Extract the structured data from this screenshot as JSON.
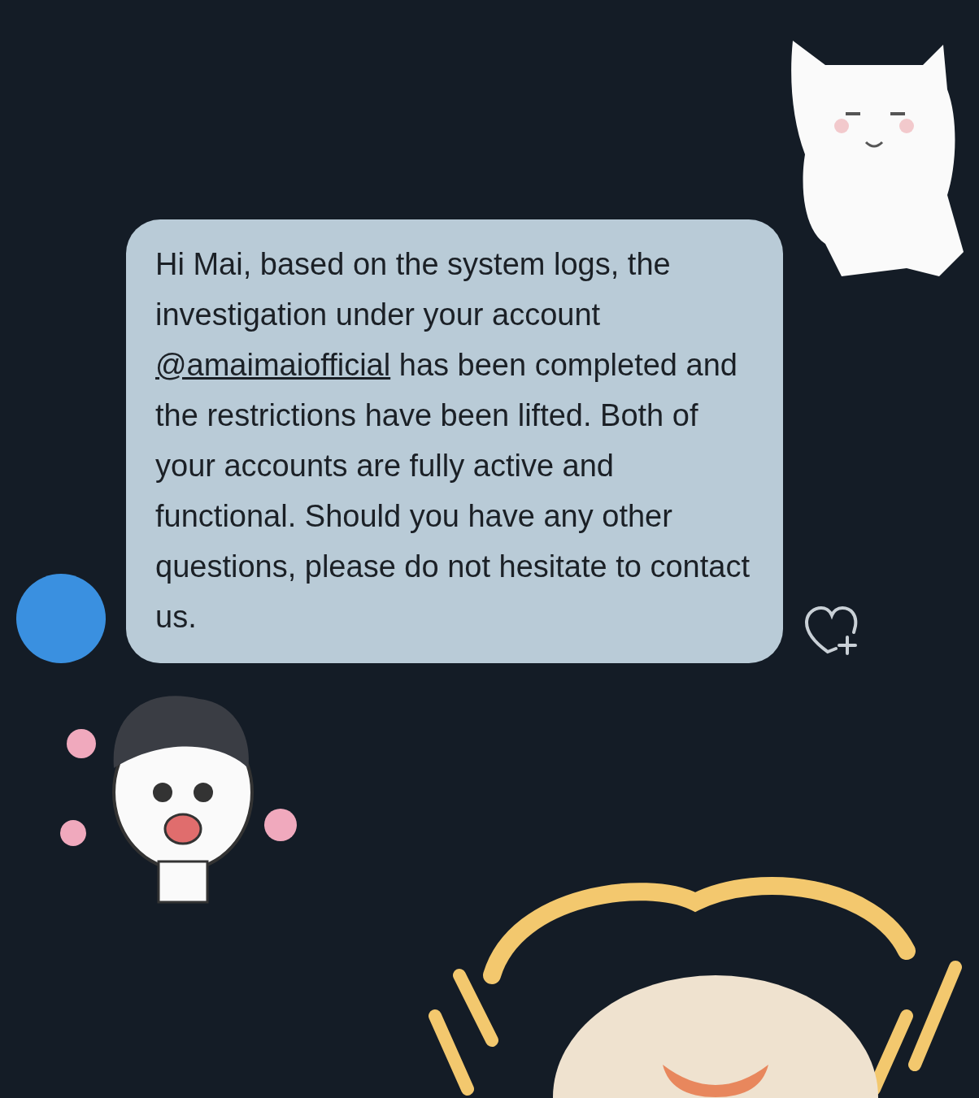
{
  "message": {
    "before": "Hi Mai, based on the system logs, the investigation under your account ",
    "mention": "@amaimaiofficial",
    "after": " has been completed and the restrictions have been lifted. Both of your accounts are fully active and functional. Should you have any other questions, please do not hesitate to contact us."
  },
  "stickers": [
    {
      "kind": "cat"
    },
    {
      "kind": "boy"
    },
    {
      "kind": "cheer"
    }
  ]
}
